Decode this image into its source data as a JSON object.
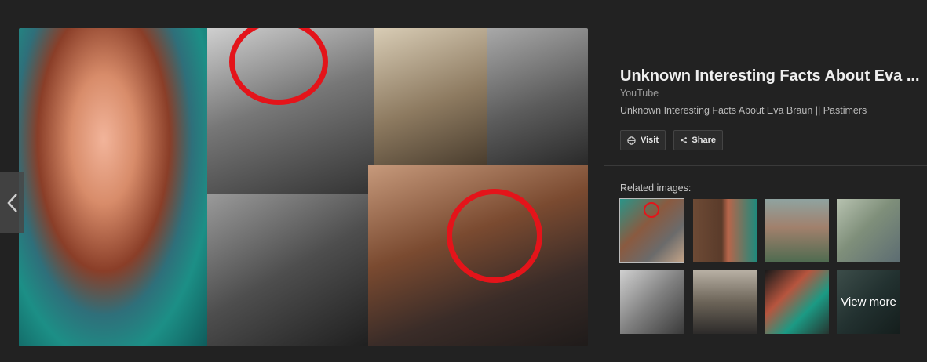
{
  "viewer": {
    "title": "Unknown Interesting Facts About Eva ...",
    "source": "YouTube",
    "description": "Unknown Interesting Facts About Eva Braun || Pastimers",
    "buttons": {
      "visit": "Visit",
      "share": "Share"
    },
    "related_label": "Related images:",
    "view_more": "View more",
    "highlight_color": "#e4141a"
  }
}
